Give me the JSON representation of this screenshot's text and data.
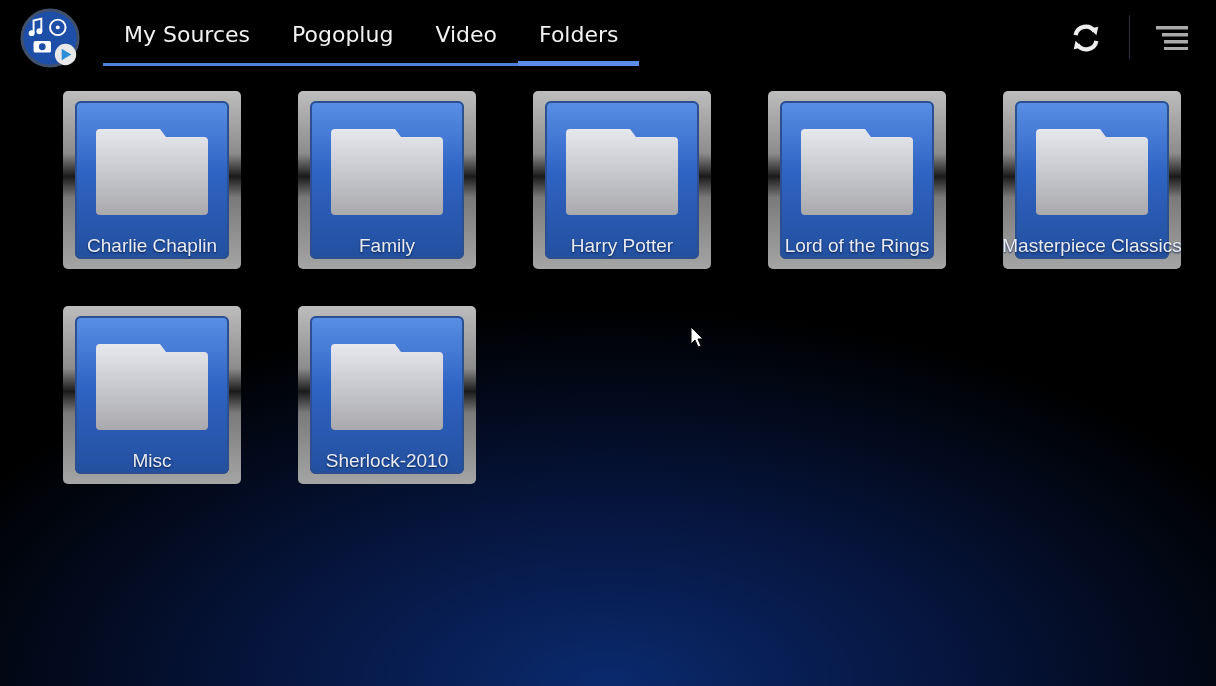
{
  "tabs": [
    {
      "label": "My Sources",
      "selected": false
    },
    {
      "label": "Pogoplug",
      "selected": false
    },
    {
      "label": "Video",
      "selected": false
    },
    {
      "label": "Folders",
      "selected": true
    }
  ],
  "folders": [
    {
      "name": "Charlie Chaplin"
    },
    {
      "name": "Family"
    },
    {
      "name": "Harry Potter"
    },
    {
      "name": "Lord of the Rings"
    },
    {
      "name": "Masterpiece Classics"
    },
    {
      "name": "Misc"
    },
    {
      "name": "Sherlock-2010"
    }
  ]
}
